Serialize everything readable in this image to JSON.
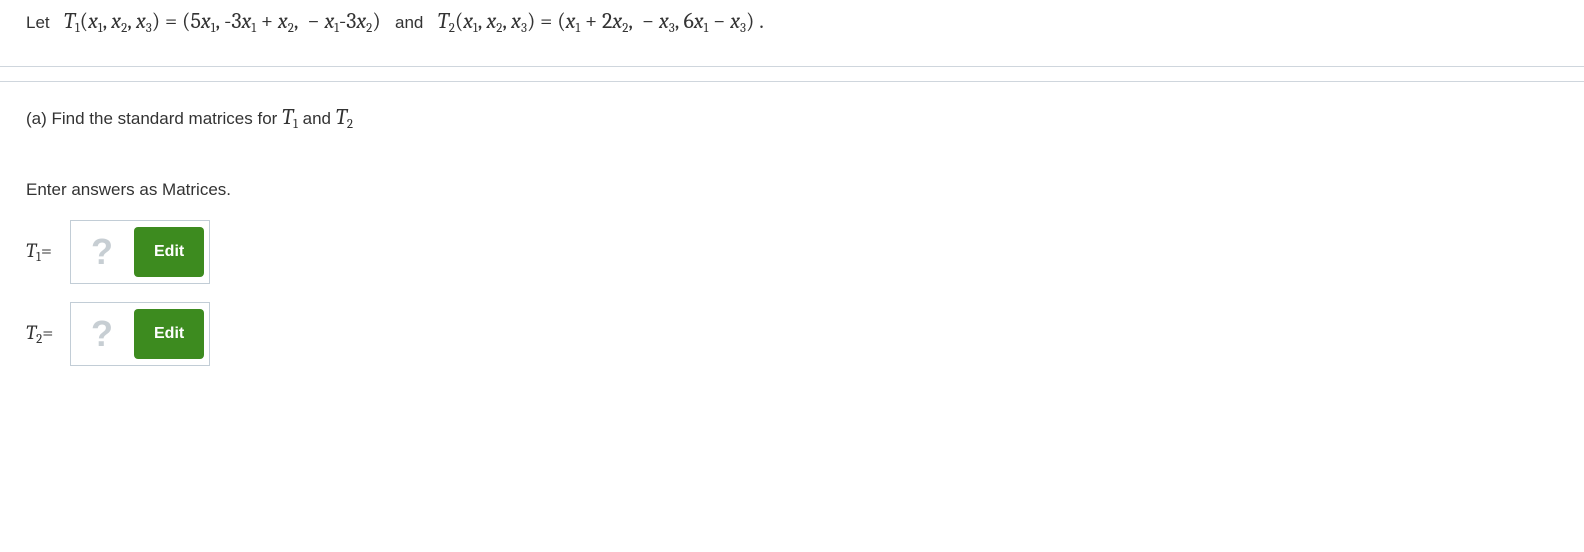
{
  "problem": {
    "let": "Let",
    "t1_lhs": "T₁(x₁, x₂, x₃) = (5x₁, -3x₁ + x₂,  − x₁-3x₂)",
    "and": "and",
    "t2_lhs": "T₂(x₁, x₂, x₃) = (x₁ + 2x₂,  − x₃, 6x₁ − x₃) ."
  },
  "part_a": {
    "prompt_pre": "(a) Find the standard matrices for ",
    "t1": "T₁",
    "mid": " and ",
    "t2": "T₂",
    "instruction": "Enter answers as Matrices.",
    "rows": [
      {
        "label": "T₁=",
        "placeholder": "?",
        "button": "Edit"
      },
      {
        "label": "T₂=",
        "placeholder": "?",
        "button": "Edit"
      }
    ]
  }
}
